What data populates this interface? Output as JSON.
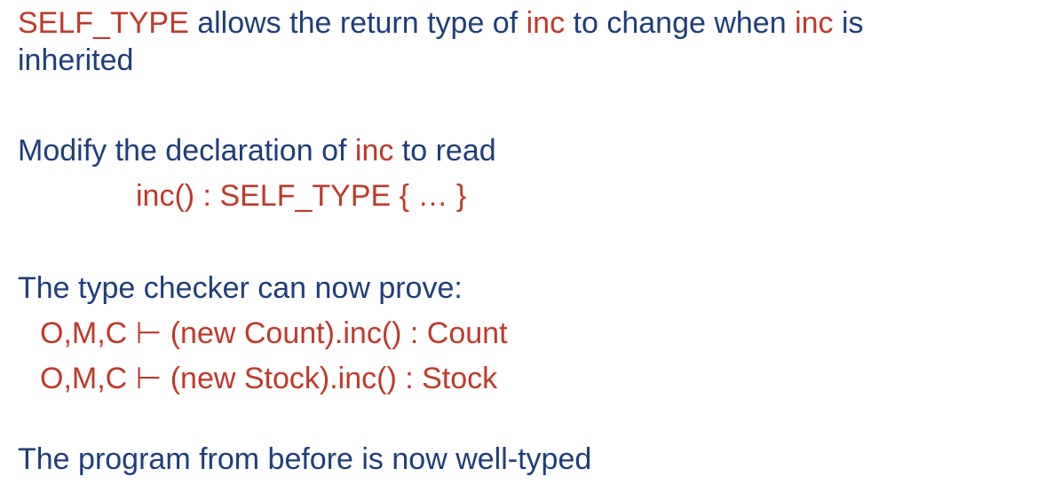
{
  "slide": {
    "line1": {
      "part1": "SELF_TYPE",
      "part2": " allows the return type of ",
      "part3": "inc",
      "part4": " to change when ",
      "part5": "inc",
      "part6": " is"
    },
    "line2": "inherited",
    "line3": {
      "part1": "Modify the declaration of ",
      "part2": "inc",
      "part3": " to read"
    },
    "code_line": "inc() : SELF_TYPE  { … }",
    "prove_heading": "The type checker can now prove:",
    "judgement1": "O,M,C ⊢  (new Count).inc() : Count",
    "judgement2": "O,M,C ⊢  (new Stock).inc() : Stock",
    "conclusion": "The program from before is now well-typed"
  },
  "colors": {
    "text_blue": "#1f3d7a",
    "text_red": "#c0392b",
    "background": "#ffffff"
  }
}
